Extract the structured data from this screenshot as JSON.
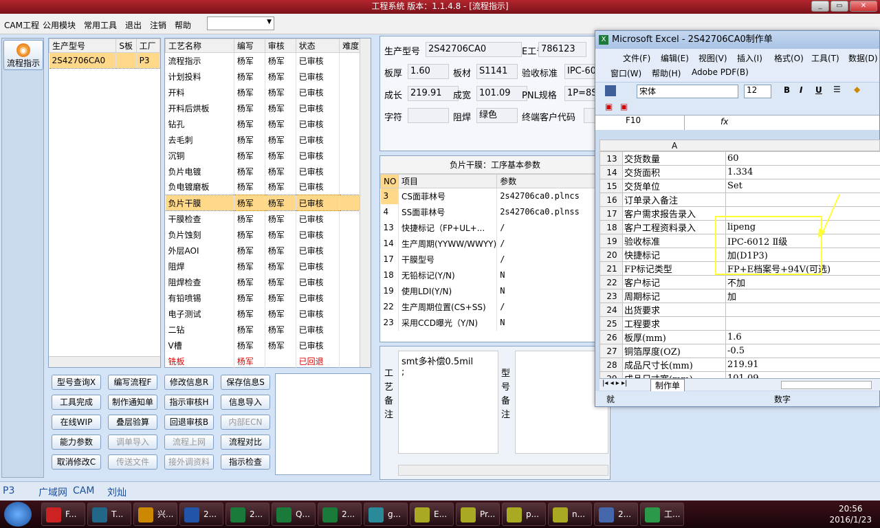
{
  "window": {
    "title": "工程系统   版本：1.1.4.8 - [流程指示]",
    "controls": [
      "_",
      "▭",
      "✕"
    ]
  },
  "menu": [
    "CAM工程",
    "公用模块",
    "常用工具",
    "退出",
    "注销",
    "帮助"
  ],
  "nav": {
    "label": "流程指示"
  },
  "models": {
    "headers": [
      "生产型号",
      "S板",
      "工厂"
    ],
    "rows": [
      [
        "2S42706CA0",
        "",
        "P3"
      ]
    ]
  },
  "process": {
    "headers": [
      "工艺名称",
      "编写",
      "审核",
      "状态",
      "难度"
    ],
    "rows": [
      [
        "流程指示",
        "杨军",
        "杨军",
        "已审核"
      ],
      [
        "计划投料",
        "杨军",
        "杨军",
        "已审核"
      ],
      [
        "开料",
        "杨军",
        "杨军",
        "已审核"
      ],
      [
        "开料后烘板",
        "杨军",
        "杨军",
        "已审核"
      ],
      [
        "钻孔",
        "杨军",
        "杨军",
        "已审核"
      ],
      [
        "去毛刺",
        "杨军",
        "杨军",
        "已审核"
      ],
      [
        "沉铜",
        "杨军",
        "杨军",
        "已审核"
      ],
      [
        "负片电镀",
        "杨军",
        "杨军",
        "已审核"
      ],
      [
        "负电镀磨板",
        "杨军",
        "杨军",
        "已审核"
      ],
      [
        "负片干膜",
        "杨军",
        "杨军",
        "已审核"
      ],
      [
        "干膜检查",
        "杨军",
        "杨军",
        "已审核"
      ],
      [
        "负片蚀刻",
        "杨军",
        "杨军",
        "已审核"
      ],
      [
        "外层AOI",
        "杨军",
        "杨军",
        "已审核"
      ],
      [
        "阻焊",
        "杨军",
        "杨军",
        "已审核"
      ],
      [
        "阻焊检查",
        "杨军",
        "杨军",
        "已审核"
      ],
      [
        "有铅喷锡",
        "杨军",
        "杨军",
        "已审核"
      ],
      [
        "电子测试",
        "杨军",
        "杨军",
        "已审核"
      ],
      [
        "二钻",
        "杨军",
        "杨军",
        "已审核"
      ],
      [
        "V槽",
        "杨军",
        "杨军",
        "已审核"
      ],
      [
        "铣板",
        "杨军",
        "",
        "已回退"
      ]
    ],
    "selected_index": 9
  },
  "buttons": [
    [
      "型号查询Ⅹ",
      "编写流程F",
      "修改信息R",
      "保存信息S"
    ],
    [
      "工具完成",
      "制作通知单",
      "指示审核H",
      "信息导入"
    ],
    [
      "在线WIP",
      "叠层验算",
      "回退审核B",
      "内部ECN"
    ],
    [
      "能力参数",
      "调单导入",
      "流程上网",
      "流程对比"
    ],
    [
      "取消修改C",
      "传送文件",
      "接外调资料",
      "指示检查"
    ]
  ],
  "disabled_buttons": [
    "内部ECN",
    "调单导入",
    "流程上网",
    "传送文件",
    "接外调资料"
  ],
  "info": {
    "labels": {
      "model": "生产型号",
      "eno": "E工号",
      "thick": "板厚",
      "material": "板材",
      "standard": "验收标准",
      "length": "成长",
      "width": "成宽",
      "pnl": "PNL规格",
      "char": "字符",
      "mask": "阻焊",
      "endcode": "终端客户代码"
    },
    "values": {
      "model": "2S42706CA0",
      "eno": "786123",
      "thick": "1.60",
      "material": "S1141",
      "standard": "IPC-60",
      "length": "219.91",
      "width": "101.09",
      "pnl": "1P=8S",
      "char": "",
      "mask": "绿色",
      "endcode": ""
    }
  },
  "params": {
    "title": "负片干膜：工序基本参数",
    "headers": [
      "NO",
      "项目",
      "参数"
    ],
    "rows": [
      [
        "3",
        "CS面菲林号",
        "2s42706ca0.plncs"
      ],
      [
        "4",
        "SS面菲林号",
        "2s42706ca0.plnss"
      ],
      [
        "13",
        "快捷标记（FP+UL+...",
        "/"
      ],
      [
        "14",
        "生产周期(YYWW/WWYY)",
        "/"
      ],
      [
        "17",
        "干膜型号",
        "/"
      ],
      [
        "18",
        "无铅标记(Y/N)",
        "N"
      ],
      [
        "19",
        "使用LDI(Y/N)",
        "N"
      ],
      [
        "22",
        "生产周期位置(CS+SS)",
        "/"
      ],
      [
        "23",
        "采用CCD曝光（Y/N)",
        "N"
      ]
    ]
  },
  "remarks": {
    "process_label": "工艺备注",
    "process_text": "smt多补偿0.5mil\n;",
    "model_label": "型号备注"
  },
  "excel": {
    "title": "Microsoft Excel - 2S42706CA0制作单",
    "menu": [
      "文件(F)",
      "编辑(E)",
      "视图(V)",
      "插入(I)",
      "格式(O)",
      "工具(T)",
      "数据(D)",
      "窗口(W)",
      "帮助(H)",
      "Adobe PDF(B)"
    ],
    "font": "宋体",
    "size": "12",
    "cell": "F10",
    "col": "A",
    "sheet": "制作单",
    "status_left": "就",
    "status_right": "数字",
    "rows": [
      [
        "13",
        "交货数量",
        "60"
      ],
      [
        "14",
        "交货面积",
        "1.334"
      ],
      [
        "15",
        "交货单位",
        "Set"
      ],
      [
        "16",
        "订单录入备注",
        ""
      ],
      [
        "17",
        "客户需求报告录入",
        ""
      ],
      [
        "18",
        "客户工程资料录入",
        "lipeng"
      ],
      [
        "19",
        "验收标准",
        "IPC-6012 Ⅱ级"
      ],
      [
        "20",
        "快捷标记",
        "加(D1P3)"
      ],
      [
        "21",
        "FP标记类型",
        "FP+E档案号+94V(可选)"
      ],
      [
        "22",
        "客户标记",
        "不加"
      ],
      [
        "23",
        "周期标记",
        "加"
      ],
      [
        "24",
        "出货要求",
        ""
      ],
      [
        "25",
        "工程要求",
        ""
      ],
      [
        "26",
        "板厚(mm)",
        "1.6"
      ],
      [
        "27",
        "铜箔厚度(OZ)",
        "-0.5"
      ],
      [
        "28",
        "成品尺寸长(mm)",
        "219.91"
      ],
      [
        "29",
        "成品尺寸宽(mm)",
        "101.09"
      ]
    ],
    "annot_color": "#ffff33"
  },
  "status": [
    "P3",
    "广域网",
    "CAM",
    "刘灿"
  ],
  "taskbar": {
    "items": [
      "F...",
      "T...",
      "兴...",
      "2...",
      "2...",
      "Q...",
      "2...",
      "g...",
      "E...",
      "Pr...",
      "p...",
      "n...",
      "2...",
      "工..."
    ],
    "time": "20:56",
    "date": "2016/1/23"
  }
}
